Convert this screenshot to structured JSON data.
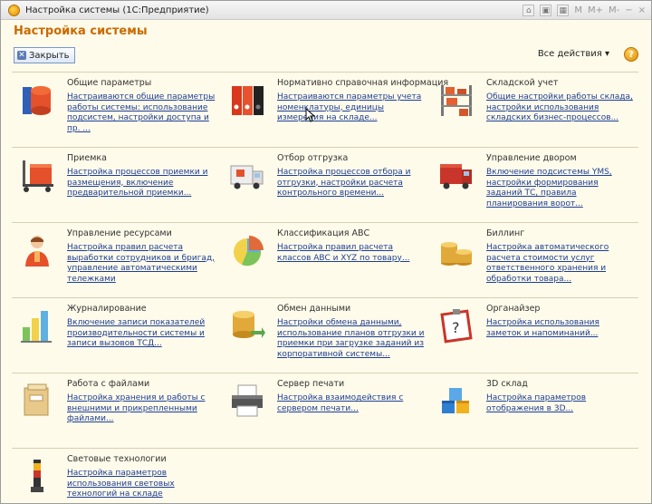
{
  "window": {
    "title": "Настройка системы  (1С:Предприятие)",
    "controls": [
      "M",
      "M+",
      "M-",
      "−",
      "×"
    ]
  },
  "page": {
    "heading": "Настройка системы"
  },
  "toolbar": {
    "close_label": "Закрыть",
    "actions_label": "Все действия ▾",
    "help_label": "?"
  },
  "sections": [
    {
      "title": "Общие параметры",
      "link": "Настраиваются общие параметры работы системы: использование подсистем, настройки доступа и пр. ...",
      "icon": "database-icon"
    },
    {
      "title": "Нормативно справочная информация",
      "link": "Настраиваются параметры учета номенклатуры, единицы измерения на складе...",
      "icon": "binders-icon"
    },
    {
      "title": "Складской учет",
      "link": "Общие настройки работы склада, настройки использования складских бизнес-процессов...",
      "icon": "warehouse-shelves-icon"
    },
    {
      "title": "Приемка",
      "link": "Настройка процессов приемки и размещения, включение предварительной приемки...",
      "icon": "pallet-jack-icon"
    },
    {
      "title": "Отбор отгрузка",
      "link": "Настройка процессов отбора и отгрузки, настройки расчета контрольного времени...",
      "icon": "delivery-truck-icon"
    },
    {
      "title": "Управление двором",
      "link": "Включение подсистемы YMS, настройки формирования заданий ТС, правила планирования ворот...",
      "icon": "red-truck-icon"
    },
    {
      "title": "Управление ресурсами",
      "link": "Настройка правил расчета выработки сотрудников и бригад, управление автоматическими тележками",
      "icon": "worker-icon"
    },
    {
      "title": "Классификация АВС",
      "link": "Настройка правил расчета классов ABC и XYZ по товару...",
      "icon": "pie-chart-icon"
    },
    {
      "title": "Биллинг",
      "link": "Настройка автоматического расчета стоимости услуг ответственного хранения и обработки товара...",
      "icon": "coins-icon"
    },
    {
      "title": "Журналирование",
      "link": "Включение записи показателей производительности системы и записи вызовов ТСД...",
      "icon": "bar-chart-icon"
    },
    {
      "title": "Обмен данными",
      "link": "Настройки обмена данными, использование планов отгрузки и приемки при загрузке заданий из корпоративной системы...",
      "icon": "data-exchange-icon"
    },
    {
      "title": "Органайзер",
      "link": "Настройка использования заметок и напоминаний...",
      "icon": "organizer-note-icon"
    },
    {
      "title": "Работа с файлами",
      "link": "Настройка хранения и работы с внешними и прикрепленными файлами...",
      "icon": "file-box-icon"
    },
    {
      "title": "Сервер печати",
      "link": "Настройка взаимодействия с сервером печати...",
      "icon": "printer-icon"
    },
    {
      "title": "3D склад",
      "link": "Настройка параметров отображения в 3D...",
      "icon": "3d-cubes-icon"
    },
    {
      "title": "Световые технологии",
      "link": "Настройка параметров использования световых технологий на складе",
      "icon": "signal-light-icon"
    }
  ]
}
